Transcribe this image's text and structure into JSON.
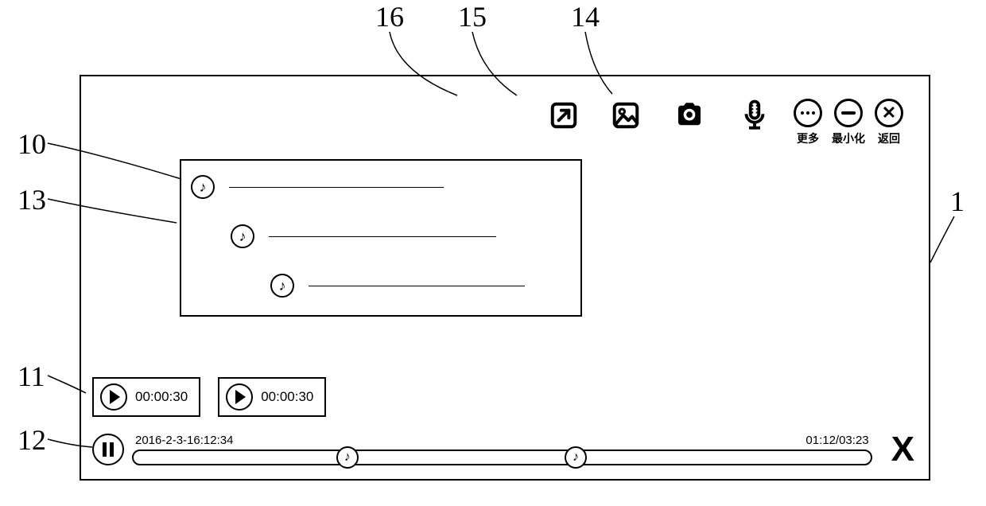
{
  "callouts": {
    "c16": "16",
    "c15": "15",
    "c14": "14",
    "c10": "10",
    "c13": "13",
    "c11": "11",
    "c12": "12",
    "c1": "1"
  },
  "toolbar": {
    "more_label": "更多",
    "minimize_label": "最小化",
    "close_label": "返回"
  },
  "panel": {
    "rows": [
      {
        "indent": 12,
        "line": 270
      },
      {
        "indent": 62,
        "line": 286
      },
      {
        "indent": 112,
        "line": 272
      }
    ]
  },
  "clips": [
    {
      "time": "00:00:30"
    },
    {
      "time": "00:00:30"
    }
  ],
  "timeline": {
    "start_label": "2016-2-3-16:12:34",
    "elapsed_label": "01:12/03:23",
    "marker_positions": [
      29,
      60
    ]
  }
}
